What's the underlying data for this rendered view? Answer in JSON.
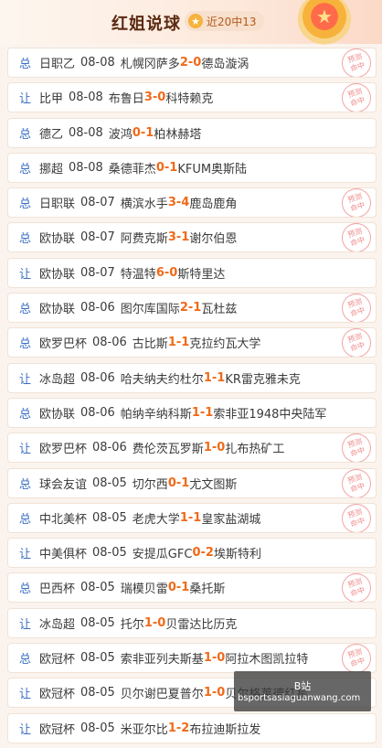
{
  "header": {
    "title": "红姐说球",
    "record": "近20中13"
  },
  "rows": [
    {
      "type": "总",
      "league": "日职乙",
      "date": "08-08",
      "home": "札幌冈萨多",
      "hs": "2",
      "sep": " - ",
      "as": "0",
      "away": "德岛漩涡",
      "hit": true
    },
    {
      "type": "让",
      "league": "比甲",
      "date": "08-08",
      "home": "布鲁日",
      "hs": "3",
      "sep": " - ",
      "as": "0",
      "away": "科特赖克",
      "hit": true
    },
    {
      "type": "总",
      "league": "德乙",
      "date": "08-08",
      "home": "波鸿",
      "hs": "0",
      "sep": " - ",
      "as": "1",
      "away": "柏林赫塔",
      "hit": false
    },
    {
      "type": "总",
      "league": "挪超",
      "date": "08-08",
      "home": "桑德菲杰",
      "hs": "0",
      "sep": " - ",
      "as": "1",
      "away": "KFUM奥斯陆",
      "hit": false
    },
    {
      "type": "总",
      "league": "日职联",
      "date": "08-07",
      "home": "横滨水手",
      "hs": "3",
      "sep": " - ",
      "as": "4",
      "away": "鹿岛鹿角",
      "hit": true
    },
    {
      "type": "总",
      "league": "欧协联",
      "date": "08-07",
      "home": "阿费克斯",
      "hs": "3",
      "sep": " - ",
      "as": "1",
      "away": "谢尔伯恩",
      "hit": true
    },
    {
      "type": "让",
      "league": "欧协联",
      "date": "08-07",
      "home": "特温特",
      "hs": "6",
      "sep": " - ",
      "as": "0",
      "away": "斯特里达",
      "hit": false
    },
    {
      "type": "总",
      "league": "欧协联",
      "date": "08-06",
      "home": "图尔库国际",
      "hs": "2",
      "sep": " - ",
      "as": "1",
      "away": "瓦杜兹",
      "hit": true
    },
    {
      "type": "总",
      "league": "欧罗巴杯",
      "date": "08-06",
      "home": "古比斯",
      "hs": "1",
      "sep": " - ",
      "as": "1",
      "away": "克拉约瓦大学",
      "hit": true
    },
    {
      "type": "让",
      "league": "冰岛超",
      "date": "08-06",
      "home": "哈夫纳夫约杜尔",
      "hs": "1",
      "sep": " - ",
      "as": "1",
      "away": "KR雷克雅未克",
      "hit": false
    },
    {
      "type": "总",
      "league": "欧协联",
      "date": "08-06",
      "home": "帕纳辛纳科斯",
      "hs": "1",
      "sep": " - ",
      "as": "1",
      "away": "索非亚1948中央陆军",
      "hit": false
    },
    {
      "type": "让",
      "league": "欧罗巴杯",
      "date": "08-06",
      "home": "费伦茨瓦罗斯",
      "hs": "1",
      "sep": " - ",
      "as": "0",
      "away": "扎布热矿工",
      "hit": true
    },
    {
      "type": "总",
      "league": "球会友谊",
      "date": "08-05",
      "home": "切尔西",
      "hs": "0",
      "sep": " - ",
      "as": "1",
      "away": "尤文图斯",
      "hit": true
    },
    {
      "type": "总",
      "league": "中北美杯",
      "date": "08-05",
      "home": "老虎大学",
      "hs": "1",
      "sep": " - ",
      "as": "1",
      "away": "皇家盐湖城",
      "hit": true
    },
    {
      "type": "让",
      "league": "中美俱杯",
      "date": "08-05",
      "home": "安提瓜GFC",
      "hs": "0",
      "sep": " - ",
      "as": "2",
      "away": "埃斯特利",
      "hit": false
    },
    {
      "type": "总",
      "league": "巴西杯",
      "date": "08-05",
      "home": "瑞模贝雷",
      "hs": "0",
      "sep": " - ",
      "as": "1",
      "away": "桑托斯",
      "hit": true
    },
    {
      "type": "让",
      "league": "冰岛超",
      "date": "08-05",
      "home": "托尔",
      "hs": "1",
      "sep": " - ",
      "as": "0",
      "away": "贝雷达比历克",
      "hit": false
    },
    {
      "type": "总",
      "league": "欧冠杯",
      "date": "08-05",
      "home": "索非亚列夫斯基",
      "hs": "1",
      "sep": " - ",
      "as": "0",
      "away": "阿拉木图凯拉特",
      "hit": true
    },
    {
      "type": "让",
      "league": "欧冠杯",
      "date": "08-05",
      "home": "贝尔谢巴夏普尔",
      "hs": "1",
      "sep": " - ",
      "as": "0",
      "away": "贝尔格莱德红星",
      "hit": false
    },
    {
      "type": "让",
      "league": "欧冠杯",
      "date": "08-05",
      "home": "米亚尔比",
      "hs": "1",
      "sep": " - ",
      "as": "2",
      "away": "布拉迪斯拉发",
      "hit": false
    }
  ],
  "stamp": {
    "line1": "预测",
    "line2": "命中"
  },
  "overlay": {
    "label": "B站",
    "url": "bsportsasiaguanwang.com"
  }
}
